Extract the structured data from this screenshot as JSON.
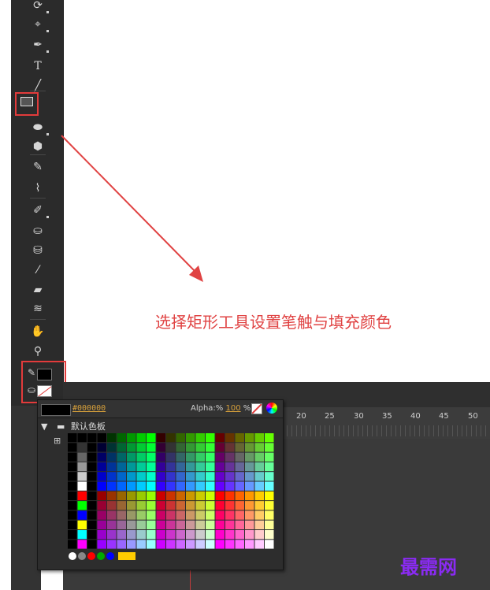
{
  "tools": [
    {
      "name": "subselection",
      "glyph": "⟳"
    },
    {
      "name": "lasso",
      "glyph": "⌖"
    },
    {
      "name": "pen",
      "glyph": "✒"
    },
    {
      "name": "text",
      "glyph": "T"
    },
    {
      "name": "line",
      "glyph": "╱"
    },
    {
      "name": "rectangle",
      "glyph": ""
    },
    {
      "name": "oval",
      "glyph": "⬬"
    },
    {
      "name": "polystar",
      "glyph": "⬢"
    },
    {
      "name": "pencil",
      "glyph": "✎"
    },
    {
      "name": "brush",
      "glyph": "⌇"
    },
    {
      "name": "bone",
      "glyph": "✐"
    },
    {
      "name": "paint-bucket",
      "glyph": "⛀"
    },
    {
      "name": "ink-bottle",
      "glyph": "⛁"
    },
    {
      "name": "eyedropper",
      "glyph": "⁄"
    },
    {
      "name": "eraser",
      "glyph": "▰"
    },
    {
      "name": "width",
      "glyph": "≋"
    },
    {
      "name": "hand",
      "glyph": "✋"
    },
    {
      "name": "zoom",
      "glyph": "⚲"
    }
  ],
  "annotation": "选择矩形工具设置笔触与填充颜色",
  "colorpanel": {
    "hex": "#000000",
    "alpha_label": "Alpha:%",
    "alpha_value": "100",
    "alpha_suffix": "%",
    "palette_name": "默认色板"
  },
  "ruler_labels": [
    "20",
    "25",
    "30",
    "35",
    "40",
    "45",
    "50"
  ],
  "watermark": "最需网",
  "colors": {
    "accent_red": "#e23b3b",
    "hex_text": "#d7a03b",
    "watermark": "#8a2bf2"
  }
}
